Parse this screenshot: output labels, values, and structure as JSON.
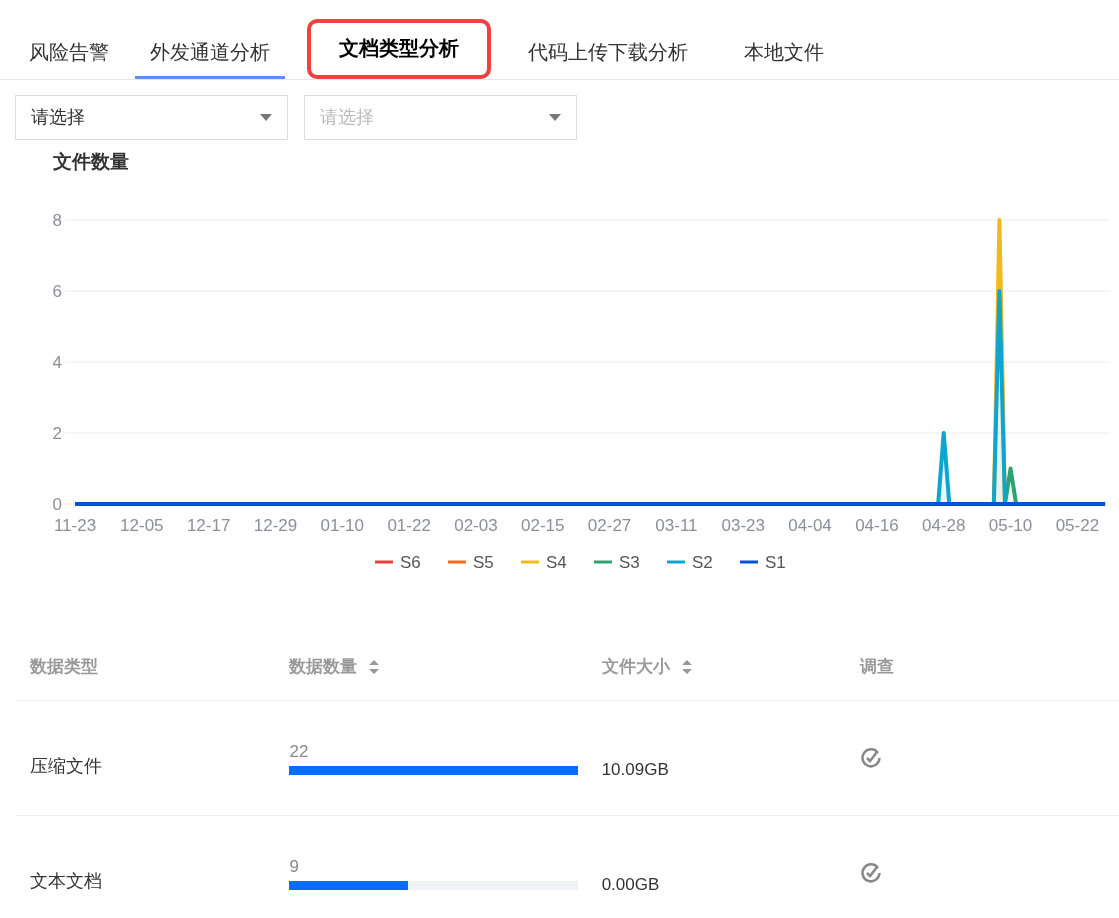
{
  "tabs": [
    {
      "label": "风险告警",
      "selected": false,
      "highlighted": false
    },
    {
      "label": "外发通道分析",
      "selected": true,
      "highlighted": false
    },
    {
      "label": "文档类型分析",
      "selected": false,
      "highlighted": true
    },
    {
      "label": "代码上传下载分析",
      "selected": false,
      "highlighted": false
    },
    {
      "label": "本地文件",
      "selected": false,
      "highlighted": false
    }
  ],
  "filters": [
    {
      "value": "请选择"
    },
    {
      "placeholder": "请选择"
    }
  ],
  "chart": {
    "chart_data": {
      "type": "line",
      "title": "文件数量",
      "grid": true,
      "legend": "bottom",
      "ylim": [
        0,
        8
      ],
      "yticks": [
        0,
        2,
        4,
        6,
        8
      ],
      "categories": [
        "11-23",
        null,
        null,
        null,
        null,
        null,
        null,
        null,
        null,
        null,
        null,
        null,
        "12-05",
        null,
        null,
        null,
        null,
        null,
        null,
        null,
        null,
        null,
        null,
        null,
        "12-17",
        null,
        null,
        null,
        null,
        null,
        null,
        null,
        null,
        null,
        null,
        null,
        "12-29",
        null,
        null,
        null,
        null,
        null,
        null,
        null,
        null,
        null,
        null,
        null,
        "01-10",
        null,
        null,
        null,
        null,
        null,
        null,
        null,
        null,
        null,
        null,
        null,
        "01-22",
        null,
        null,
        null,
        null,
        null,
        null,
        null,
        null,
        null,
        null,
        null,
        "02-03",
        null,
        null,
        null,
        null,
        null,
        null,
        null,
        null,
        null,
        null,
        null,
        "02-15",
        null,
        null,
        null,
        null,
        null,
        null,
        null,
        null,
        null,
        null,
        null,
        "02-27",
        null,
        null,
        null,
        null,
        null,
        null,
        null,
        null,
        null,
        null,
        null,
        "03-11",
        null,
        null,
        null,
        null,
        null,
        null,
        null,
        null,
        null,
        null,
        null,
        "03-23",
        null,
        null,
        null,
        null,
        null,
        null,
        null,
        null,
        null,
        null,
        null,
        "04-04",
        null,
        null,
        null,
        null,
        null,
        null,
        null,
        null,
        null,
        null,
        null,
        "04-16",
        null,
        null,
        null,
        null,
        null,
        null,
        null,
        null,
        null,
        null,
        null,
        "04-28",
        null,
        null,
        null,
        null,
        null,
        null,
        null,
        null,
        null,
        null,
        null,
        "05-10",
        null,
        null,
        null,
        null,
        null,
        null,
        null,
        null,
        null,
        null,
        null,
        "05-22",
        null,
        null,
        null,
        null,
        null
      ],
      "series": [
        {
          "name": "S6",
          "color": "#e8403a",
          "values": [
            null,
            null,
            null,
            null,
            null,
            null,
            null,
            null,
            null,
            null,
            null,
            null,
            null,
            null,
            null,
            null,
            null,
            null,
            null,
            null,
            null,
            null,
            null,
            null,
            null,
            null,
            null,
            null,
            null,
            null,
            null,
            null,
            null,
            null,
            null,
            null,
            null,
            null,
            null,
            null,
            null,
            null,
            null,
            null,
            null,
            null,
            null,
            null,
            null,
            null,
            null,
            null,
            null,
            null,
            null,
            null,
            null,
            null,
            null,
            null,
            null,
            null,
            null,
            null,
            null,
            null,
            null,
            null,
            null,
            null,
            null,
            null,
            null,
            null,
            null,
            null,
            null,
            null,
            null,
            null,
            null,
            null,
            null,
            null,
            null,
            null,
            null,
            null,
            null,
            null,
            null,
            null,
            null,
            null,
            null,
            null,
            null,
            null,
            null,
            null,
            null,
            null,
            null,
            null,
            null,
            null,
            null,
            null,
            null,
            null,
            null,
            null,
            null,
            null,
            null,
            null,
            null,
            null,
            null,
            null,
            null,
            null,
            null,
            null,
            null,
            null,
            null,
            null,
            null,
            null,
            null,
            null,
            null,
            null,
            null,
            null,
            null,
            null,
            null,
            null,
            null,
            null,
            null,
            null,
            null,
            null,
            null,
            null,
            null,
            null,
            null,
            null,
            null,
            null,
            null,
            null,
            null,
            null,
            null,
            null,
            null,
            null,
            null,
            null,
            null,
            null,
            null,
            null,
            null,
            null,
            null,
            null,
            null,
            null,
            null,
            null,
            null,
            null,
            null,
            null,
            null,
            null,
            null,
            null,
            null,
            null
          ]
        },
        {
          "name": "S5",
          "color": "#f26b1d",
          "values": [
            null,
            null,
            null,
            null,
            null,
            null,
            null,
            null,
            null,
            null,
            null,
            null,
            null,
            null,
            null,
            null,
            null,
            null,
            null,
            null,
            null,
            null,
            null,
            null,
            null,
            null,
            null,
            null,
            null,
            null,
            null,
            null,
            null,
            null,
            null,
            null,
            null,
            null,
            null,
            null,
            null,
            null,
            null,
            null,
            null,
            null,
            null,
            null,
            null,
            null,
            null,
            null,
            null,
            null,
            null,
            null,
            null,
            null,
            null,
            null,
            null,
            null,
            null,
            null,
            null,
            null,
            null,
            null,
            null,
            null,
            null,
            null,
            null,
            null,
            null,
            null,
            null,
            null,
            null,
            null,
            null,
            null,
            null,
            null,
            null,
            null,
            null,
            null,
            null,
            null,
            null,
            null,
            null,
            null,
            null,
            null,
            null,
            null,
            null,
            null,
            null,
            null,
            null,
            null,
            null,
            null,
            null,
            null,
            null,
            null,
            null,
            null,
            null,
            null,
            null,
            null,
            null,
            null,
            null,
            null,
            null,
            null,
            null,
            null,
            null,
            null,
            null,
            null,
            null,
            null,
            null,
            null,
            null,
            null,
            null,
            null,
            null,
            null,
            null,
            null,
            null,
            null,
            null,
            null,
            null,
            null,
            null,
            null,
            null,
            null,
            null,
            null,
            null,
            null,
            null,
            null,
            null,
            null,
            null,
            null,
            null,
            null,
            null,
            null,
            null,
            null,
            null,
            null,
            null,
            null,
            null,
            null,
            null,
            null,
            null,
            null,
            null,
            null,
            null,
            null,
            null,
            null,
            null,
            null,
            null,
            null
          ]
        },
        {
          "name": "S4",
          "color": "#f5b81c",
          "values": [
            null,
            null,
            null,
            null,
            null,
            null,
            null,
            null,
            null,
            null,
            null,
            null,
            null,
            null,
            null,
            null,
            null,
            null,
            null,
            null,
            null,
            null,
            null,
            null,
            null,
            null,
            null,
            null,
            null,
            null,
            null,
            null,
            null,
            null,
            null,
            null,
            null,
            null,
            null,
            null,
            null,
            null,
            null,
            null,
            null,
            null,
            null,
            null,
            null,
            null,
            null,
            null,
            null,
            null,
            null,
            null,
            null,
            null,
            null,
            null,
            null,
            null,
            null,
            null,
            null,
            null,
            null,
            null,
            null,
            null,
            null,
            null,
            null,
            null,
            null,
            null,
            null,
            null,
            null,
            null,
            null,
            null,
            null,
            null,
            null,
            null,
            null,
            null,
            null,
            null,
            null,
            null,
            null,
            null,
            null,
            null,
            null,
            null,
            null,
            null,
            null,
            null,
            null,
            null,
            null,
            null,
            null,
            null,
            null,
            null,
            null,
            null,
            null,
            null,
            null,
            null,
            null,
            null,
            null,
            null,
            null,
            null,
            null,
            null,
            null,
            null,
            null,
            null,
            null,
            null,
            null,
            null,
            null,
            null,
            null,
            null,
            null,
            null,
            null,
            null,
            null,
            null,
            null,
            null,
            null,
            null,
            null,
            null,
            null,
            null,
            null,
            null,
            null,
            null,
            null,
            null,
            null,
            null,
            null,
            null,
            null,
            null,
            null,
            null,
            null,
            0,
            8,
            0,
            null,
            null,
            null,
            null,
            null,
            null,
            null,
            null,
            null,
            null,
            null,
            null,
            null,
            null,
            null,
            null,
            null,
            null
          ]
        },
        {
          "name": "S3",
          "color": "#2ba471",
          "values": [
            null,
            null,
            null,
            null,
            null,
            null,
            null,
            null,
            null,
            null,
            null,
            null,
            null,
            null,
            null,
            null,
            null,
            null,
            null,
            null,
            null,
            null,
            null,
            null,
            null,
            null,
            null,
            null,
            null,
            null,
            null,
            null,
            null,
            null,
            null,
            null,
            null,
            null,
            null,
            null,
            null,
            null,
            null,
            null,
            null,
            null,
            null,
            null,
            null,
            null,
            null,
            null,
            null,
            null,
            null,
            null,
            null,
            null,
            null,
            null,
            null,
            null,
            null,
            null,
            null,
            null,
            null,
            null,
            null,
            null,
            null,
            null,
            null,
            null,
            null,
            null,
            null,
            null,
            null,
            null,
            null,
            null,
            null,
            null,
            null,
            null,
            null,
            null,
            null,
            null,
            null,
            null,
            null,
            null,
            null,
            null,
            null,
            null,
            null,
            null,
            null,
            null,
            null,
            null,
            null,
            null,
            null,
            null,
            null,
            null,
            null,
            null,
            null,
            null,
            null,
            null,
            null,
            null,
            null,
            null,
            null,
            null,
            null,
            null,
            null,
            null,
            null,
            null,
            null,
            null,
            null,
            null,
            null,
            null,
            null,
            null,
            null,
            null,
            null,
            null,
            null,
            null,
            null,
            null,
            null,
            null,
            null,
            null,
            null,
            null,
            null,
            null,
            null,
            null,
            null,
            null,
            null,
            null,
            null,
            null,
            null,
            null,
            null,
            null,
            null,
            null,
            null,
            0,
            1,
            0,
            null,
            null,
            null,
            null,
            null,
            null,
            null,
            null,
            null,
            null,
            null,
            null,
            null,
            null,
            null,
            null
          ]
        },
        {
          "name": "S2",
          "color": "#0ea5d0",
          "values": [
            null,
            null,
            null,
            null,
            null,
            null,
            null,
            null,
            null,
            null,
            null,
            null,
            null,
            null,
            null,
            null,
            null,
            null,
            null,
            null,
            null,
            null,
            null,
            null,
            null,
            null,
            null,
            null,
            null,
            null,
            null,
            null,
            null,
            null,
            null,
            null,
            null,
            null,
            null,
            null,
            null,
            null,
            null,
            null,
            null,
            null,
            null,
            null,
            null,
            null,
            null,
            null,
            null,
            null,
            null,
            null,
            null,
            null,
            null,
            null,
            null,
            null,
            null,
            null,
            null,
            null,
            null,
            null,
            null,
            null,
            null,
            null,
            null,
            null,
            null,
            null,
            null,
            null,
            null,
            null,
            null,
            null,
            null,
            null,
            null,
            null,
            null,
            null,
            null,
            null,
            null,
            null,
            null,
            null,
            null,
            null,
            null,
            null,
            null,
            null,
            null,
            null,
            null,
            null,
            null,
            null,
            null,
            null,
            null,
            null,
            null,
            null,
            null,
            null,
            null,
            null,
            null,
            null,
            null,
            null,
            null,
            null,
            null,
            null,
            null,
            null,
            null,
            null,
            null,
            null,
            null,
            null,
            null,
            null,
            null,
            null,
            null,
            null,
            null,
            null,
            null,
            null,
            null,
            null,
            null,
            null,
            null,
            null,
            null,
            null,
            null,
            null,
            null,
            null,
            null,
            0,
            2,
            0,
            null,
            null,
            null,
            null,
            null,
            null,
            null,
            0,
            6,
            0,
            null,
            null,
            null,
            null,
            null,
            null,
            null,
            null,
            null,
            null,
            null,
            null,
            null,
            null,
            null,
            null,
            null,
            null
          ]
        },
        {
          "name": "S1",
          "color": "#0052d9",
          "values": [
            0,
            0,
            0,
            0,
            0,
            0,
            0,
            0,
            0,
            0,
            0,
            0,
            0,
            0,
            0,
            0,
            0,
            0,
            0,
            0,
            0,
            0,
            0,
            0,
            0,
            0,
            0,
            0,
            0,
            0,
            0,
            0,
            0,
            0,
            0,
            0,
            0,
            0,
            0,
            0,
            0,
            0,
            0,
            0,
            0,
            0,
            0,
            0,
            0,
            0,
            0,
            0,
            0,
            0,
            0,
            0,
            0,
            0,
            0,
            0,
            0,
            0,
            0,
            0,
            0,
            0,
            0,
            0,
            0,
            0,
            0,
            0,
            0,
            0,
            0,
            0,
            0,
            0,
            0,
            0,
            0,
            0,
            0,
            0,
            0,
            0,
            0,
            0,
            0,
            0,
            0,
            0,
            0,
            0,
            0,
            0,
            0,
            0,
            0,
            0,
            0,
            0,
            0,
            0,
            0,
            0,
            0,
            0,
            0,
            0,
            0,
            0,
            0,
            0,
            0,
            0,
            0,
            0,
            0,
            0,
            0,
            0,
            0,
            0,
            0,
            0,
            0,
            0,
            0,
            0,
            0,
            0,
            0,
            0,
            0,
            0,
            0,
            0,
            0,
            0,
            0,
            0,
            0,
            0,
            0,
            0,
            0,
            0,
            0,
            0,
            0,
            0,
            0,
            0,
            0,
            0,
            0,
            0,
            0,
            0,
            0,
            0,
            0,
            0,
            0,
            0,
            0,
            0,
            0,
            0,
            0,
            0,
            0,
            0,
            0,
            0,
            0,
            0,
            0,
            0,
            0,
            0,
            0,
            0,
            0,
            0
          ]
        }
      ]
    }
  },
  "table": {
    "columns": [
      {
        "label": "数据类型",
        "sortable": false
      },
      {
        "label": "数据数量",
        "sortable": true
      },
      {
        "label": "文件大小",
        "sortable": true
      },
      {
        "label": "调查",
        "sortable": false
      }
    ],
    "rows": [
      {
        "type": "压缩文件",
        "count": "22",
        "level": 1,
        "size": "10.09GB"
      },
      {
        "type": "文本文档",
        "count": "9",
        "level": 0.41,
        "size": "0.00GB"
      }
    ]
  }
}
